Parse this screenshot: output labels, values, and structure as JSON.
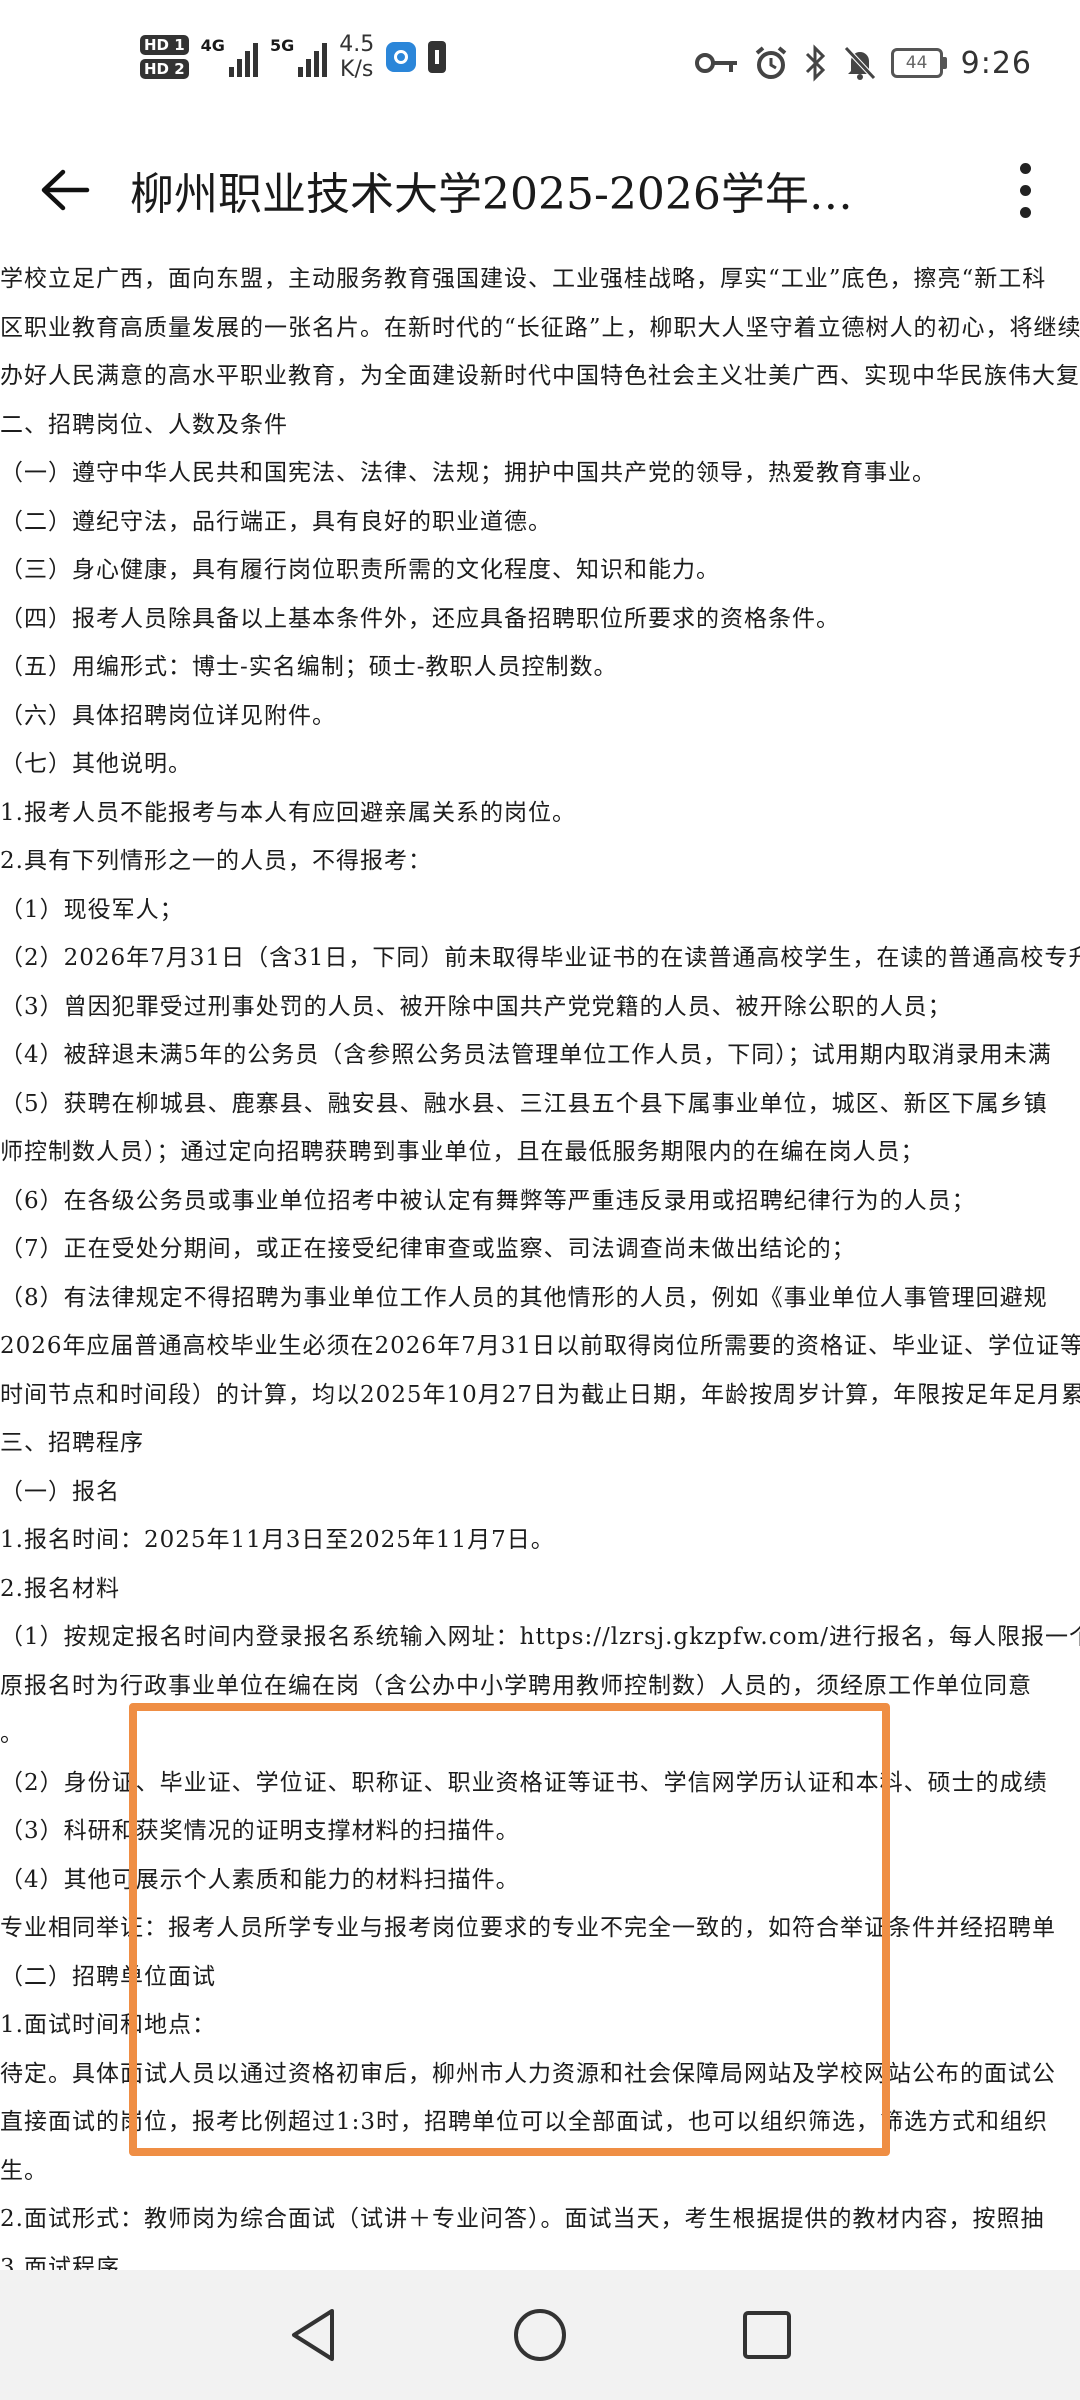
{
  "status_bar": {
    "sim1": "HD 1",
    "sim2": "HD 2",
    "net1": "4G",
    "net2": "5G",
    "speed_value": "4.5",
    "speed_unit": "K/s",
    "battery": "44",
    "time": "9:26",
    "icons": [
      "key-icon",
      "alarm-icon",
      "bluetooth-icon",
      "mute-icon",
      "battery-icon"
    ]
  },
  "header": {
    "title": "柳州职业技术大学2025-2026学年…"
  },
  "document": {
    "lines": [
      "  学校立足广西，面向东盟，主动服务教育强国建设、工业强桂战略，厚实“工业”底色，擦亮“新工科",
      "区职业教育高质量发展的一张名片。在新时代的“长征路”上，柳职大人坚守着立德树人的初心，将继续",
      "办好人民满意的高水平职业教育，为全面建设新时代中国特色社会主义壮美广西、实现中华民族伟大复",
      "  二、招聘岗位、人数及条件",
      "  （一）遵守中华人民共和国宪法、法律、法规；拥护中国共产党的领导，热爱教育事业。",
      "  （二）遵纪守法，品行端正，具有良好的职业道德。",
      "  （三）身心健康，具有履行岗位职责所需的文化程度、知识和能力。",
      "  （四）报考人员除具备以上基本条件外，还应具备招聘职位所要求的资格条件。",
      "  （五）用编形式：博士-实名编制；硕士-教职人员控制数。",
      "  （六）具体招聘岗位详见附件。",
      "  （七）其他说明。",
      "  1.报考人员不能报考与本人有应回避亲属关系的岗位。",
      "  2.具有下列情形之一的人员，不得报考：",
      "  （1）现役军人；",
      "  （2）2026年7月31日（含31日，下同）前未取得毕业证书的在读普通高校学生，在读的普通高校专升本",
      "  （3）曾因犯罪受过刑事处罚的人员、被开除中国共产党党籍的人员、被开除公职的人员；",
      "  （4）被辞退未满5年的公务员（含参照公务员法管理单位工作人员，下同）；试用期内取消录用未满",
      "  （5）获聘在柳城县、鹿寨县、融安县、融水县、三江县五个县下属事业单位，城区、新区下属乡镇",
      "师控制数人员）；通过定向招聘获聘到事业单位，且在最低服务期限内的在编在岗人员；",
      "  （6）在各级公务员或事业单位招考中被认定有舞弊等严重违反录用或招聘纪律行为的人员；",
      "  （7）正在受处分期间，或正在接受纪律审查或监察、司法调查尚未做出结论的；",
      "  （8）有法律规定不得招聘为事业单位工作人员的其他情形的人员，例如《事业单位人事管理回避规",
      "  2026年应届普通高校毕业生必须在2026年7月31日以前取得岗位所需要的资格证、毕业证、学位证等",
      "时间节点和时间段）的计算，均以2025年10月27日为截止日期，年龄按周岁计算，年限按足年足月累计",
      "  三、招聘程序",
      "  （一）报名",
      "  1.报名时间：2025年11月3日至2025年11月7日。",
      "  2.报名材料",
      "  （1）按规定报名时间内登录报名系统输入网址：https://lzrsj.gkzpfw.com/进行报名，每人限报一个岗",
      "  原报名时为行政事业单位在编在岗（含公办中小学聘用教师控制数）人员的，须经原工作单位同意",
      "。",
      "  （2）身份证、毕业证、学位证、职称证、职业资格证等证书、学信网学历认证和本科、硕士的成绩",
      "  （3）科研和获奖情况的证明支撑材料的扫描件。",
      "  （4）其他可展示个人素质和能力的材料扫描件。",
      "  专业相同举证：报考人员所学专业与报考岗位要求的专业不完全一致的，如符合举证条件并经招聘单",
      "  （二）招聘单位面试",
      "  1.面试时间和地点：",
      "  待定。具体面试人员以通过资格初审后，柳州市人力资源和社会保障局网站及学校网站公布的面试公",
      "  直接面试的岗位，报考比例超过1:3时，招聘单位可以全部面试，也可以组织筛选，筛选方式和组织",
      "生。",
      "  2.面试形式：教师岗为综合面试（试讲＋专业问答）。面试当天，考生根据提供的教材内容，按照抽",
      "  3.面试程序"
    ]
  },
  "nav": {
    "back": "back-nav-icon",
    "home": "home-nav-icon",
    "recents": "recents-nav-icon"
  }
}
